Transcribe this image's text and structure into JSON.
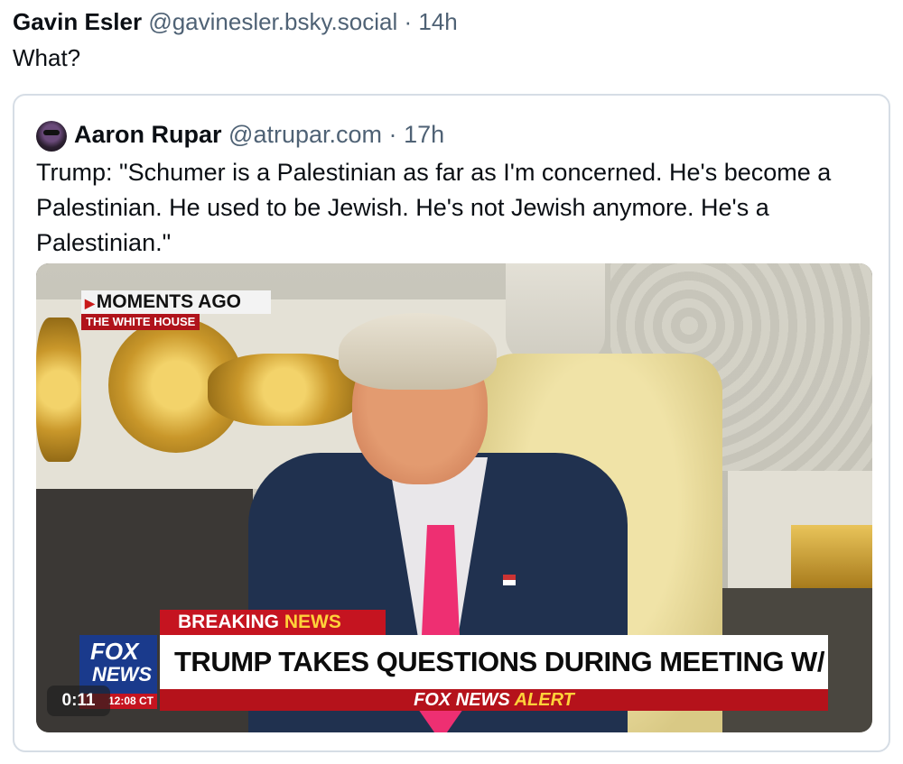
{
  "post": {
    "author": "Gavin Esler",
    "handle": "@gavinesler.bsky.social",
    "separator": "·",
    "time": "14h",
    "text": "What?"
  },
  "quoted": {
    "author": "Aaron Rupar",
    "handle": "@atrupar.com",
    "separator": "·",
    "time": "17h",
    "text": "Trump: \"Schumer is a Palestinian as far as I'm concerned. He's become a Palestinian. He used to be Jewish. He's not Jewish anymore. He's a Palestinian.\""
  },
  "video": {
    "moments_ago": "MOMENTS AGO",
    "location": "THE WHITE HOUSE",
    "breaking": "BREAKING",
    "breaking_news": "NEWS",
    "headline": "TRUMP TAKES QUESTIONS DURING MEETING W/ IRISH PM",
    "alert_prefix": "FOX NEWS",
    "alert_word": "ALERT",
    "logo_fox": "FOX",
    "logo_news": "NEWS",
    "broadcast_clock": "12:08 CT",
    "elapsed": "0:11"
  }
}
